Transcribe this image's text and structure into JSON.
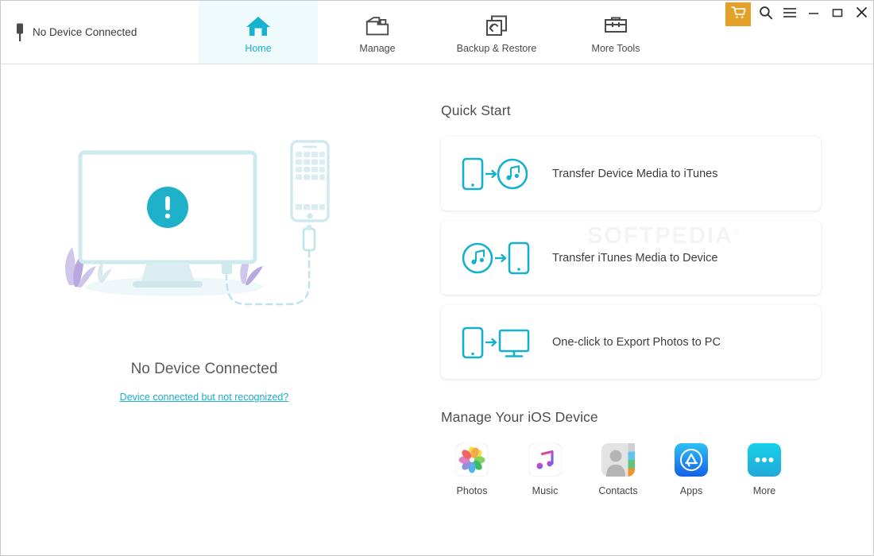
{
  "window": {
    "device_status": "No Device Connected",
    "device_status_icon": "connector-plug-icon",
    "controls": {
      "cart_icon": "shopping-cart-icon",
      "search_icon": "search-icon",
      "menu_icon": "hamburger-menu-icon",
      "minimize_icon": "minimize-icon",
      "maximize_icon": "maximize-icon",
      "close_icon": "close-icon"
    },
    "accent_color": "#17b3ce",
    "cart_color": "#e5a127",
    "active_tab_bg": "#eefafc"
  },
  "tabs": [
    {
      "label": "Home",
      "icon": "home-icon",
      "active": true
    },
    {
      "label": "Manage",
      "icon": "folder-icon",
      "active": false
    },
    {
      "label": "Backup & Restore",
      "icon": "backup-restore-icon",
      "active": false
    },
    {
      "label": "More Tools",
      "icon": "toolbox-icon",
      "active": false
    }
  ],
  "left_panel": {
    "illustration": "no-device-illustration",
    "title": "No Device Connected",
    "link": "Device connected but not recognized?"
  },
  "quick_start": {
    "title": "Quick Start",
    "items": [
      {
        "label": "Transfer Device Media to iTunes",
        "icon": "device-to-itunes-icon"
      },
      {
        "label": "Transfer iTunes Media to Device",
        "icon": "itunes-to-device-icon"
      },
      {
        "label": "One-click to Export Photos to PC",
        "icon": "device-to-pc-icon"
      }
    ]
  },
  "manage_device": {
    "title": "Manage Your iOS Device",
    "items": [
      {
        "label": "Photos",
        "icon": "photos-app-icon"
      },
      {
        "label": "Music",
        "icon": "music-app-icon"
      },
      {
        "label": "Contacts",
        "icon": "contacts-app-icon"
      },
      {
        "label": "Apps",
        "icon": "appstore-app-icon"
      },
      {
        "label": "More",
        "icon": "more-app-icon"
      }
    ]
  },
  "watermark": {
    "text": "SOFTPEDIA",
    "mark": "®"
  }
}
